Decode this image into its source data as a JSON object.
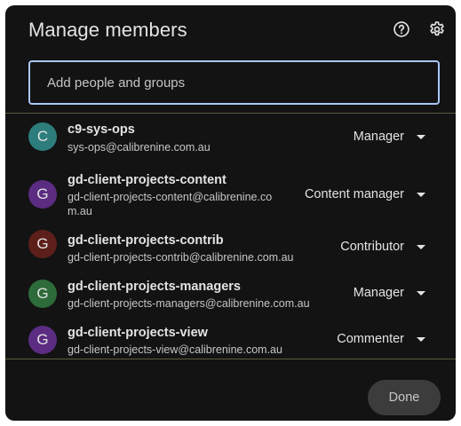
{
  "dialog": {
    "title": "Manage members",
    "help_icon": "help-circle-icon",
    "settings_icon": "gear-icon"
  },
  "add_field": {
    "placeholder": "Add people and groups",
    "value": ""
  },
  "members": [
    {
      "initial": "C",
      "name": "c9-sys-ops",
      "email": "sys-ops@calibrenine.com.au",
      "role": "Manager",
      "avatar_color": "#2e7d7d"
    },
    {
      "initial": "G",
      "name": "gd-client-projects-content",
      "email": "gd-client-projects-content@calibrenine.com.au",
      "role": "Content manager",
      "avatar_color": "#5b2c82"
    },
    {
      "initial": "G",
      "name": "gd-client-projects-contrib",
      "email": "gd-client-projects-contrib@calibrenine.com.au",
      "role": "Contributor",
      "avatar_color": "#5d1f1a"
    },
    {
      "initial": "G",
      "name": "gd-client-projects-managers",
      "email": "gd-client-projects-managers@calibrenine.com.au",
      "role": "Manager",
      "avatar_color": "#2e6b3a"
    },
    {
      "initial": "G",
      "name": "gd-client-projects-view",
      "email": "gd-client-projects-view@calibrenine.com.au",
      "role": "Commenter",
      "avatar_color": "#5b2c82"
    }
  ],
  "footer": {
    "done_label": "Done"
  },
  "colors": {
    "dialog_bg": "#131313",
    "input_border": "#a8c7fa",
    "divider": "#5c5a3c",
    "done_bg": "#3c3c3c"
  }
}
